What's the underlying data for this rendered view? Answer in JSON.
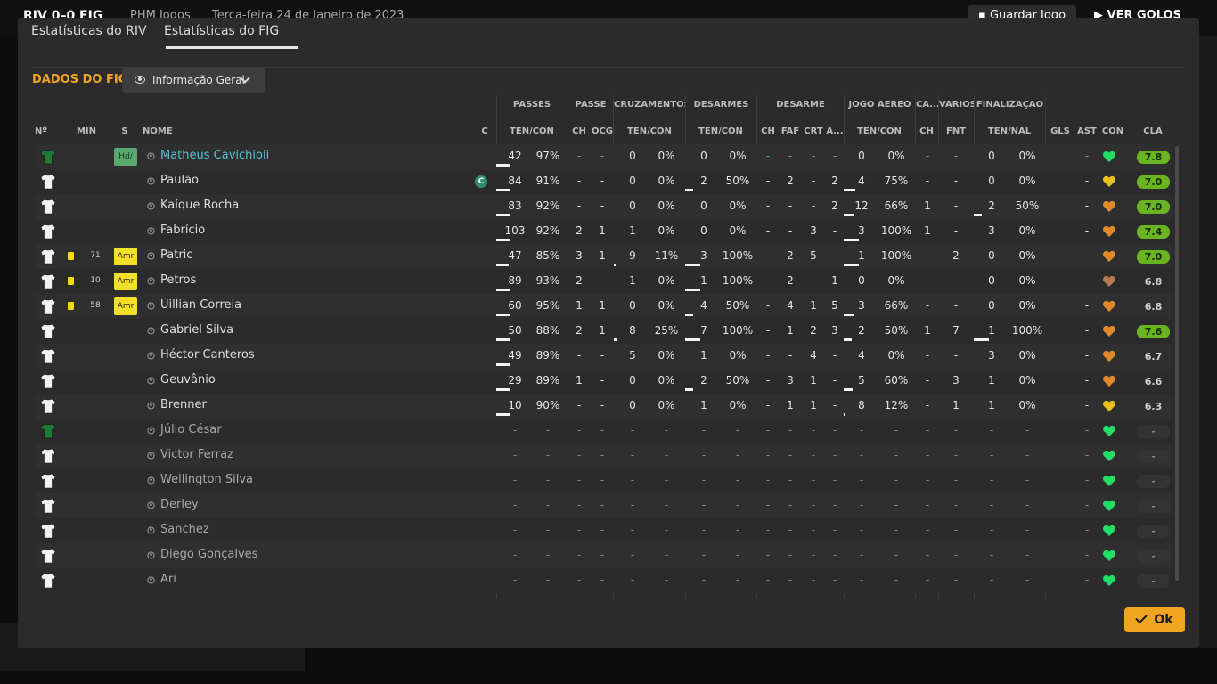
{
  "background": {
    "score": "RIV 0–0 FIG",
    "subtitle": "PHM Jogos",
    "date": "Terça-feira 24 de Janeiro de 2023",
    "save_label": "Guardar Jogo",
    "goals_label": "VER GOLOS"
  },
  "tabs": [
    {
      "label": "Estatísticas do RIV",
      "active": false
    },
    {
      "label": "Estatísticas do FIG",
      "active": true
    }
  ],
  "section": {
    "title": "DADOS DO FIG",
    "dropdown_label": "Informação Geral"
  },
  "group_headers": [
    "PASSES",
    "PASSE",
    "CRUZAMENTOS",
    "DESARMES",
    "DESARME",
    "JOGO AÉREO",
    "CA...",
    "VÁRIOS",
    "FINALIZAÇÃO"
  ],
  "columns": [
    "Nº",
    "MIN",
    "S",
    "NOME",
    "C",
    "TEN/CON",
    "CH",
    "OCG",
    "TEN/CON",
    "TEN/CON",
    "CH",
    "FAF",
    "CRT",
    "A...",
    "TEN/CON",
    "CH",
    "FNT",
    "TEN/NAL",
    "GLS",
    "AST",
    "CON",
    "CLA"
  ],
  "colors": {
    "accent": "#f0a522",
    "rating_good": "#6ab321",
    "heart_green": "#22dd66",
    "heart_yellow": "#e8c21a",
    "heart_orange": "#e08a2a",
    "heart_brown": "#b07a55"
  },
  "players": [
    {
      "kit": "gk",
      "yellow": false,
      "min": "",
      "pos": "Hd/",
      "name": "Matheus Cavichioli",
      "selected": true,
      "captain": false,
      "pass": [
        "42",
        "97%"
      ],
      "pass_ch": "-",
      "pass_ocg": "-",
      "cross": [
        "0",
        "0%"
      ],
      "tack": [
        "0",
        "0%"
      ],
      "tk_ch": "-",
      "tk_faf": "-",
      "tk_crt": "-",
      "tk_a": "-",
      "air": [
        "0",
        "0%"
      ],
      "ca_ch": "-",
      "fnt": "-",
      "shot": [
        "0",
        "0%"
      ],
      "gls": "",
      "ast": "-",
      "heart": "green",
      "rating": "7.8",
      "rating_type": "good",
      "dim": false
    },
    {
      "kit": "w",
      "yellow": false,
      "min": "",
      "pos": "",
      "name": "Paulão",
      "selected": false,
      "captain": true,
      "pass": [
        "84",
        "91%"
      ],
      "pass_ch": "-",
      "pass_ocg": "-",
      "cross": [
        "0",
        "0%"
      ],
      "tack": [
        "2",
        "50%"
      ],
      "tk_ch": "-",
      "tk_faf": "2",
      "tk_crt": "-",
      "tk_a": "2",
      "air": [
        "4",
        "75%"
      ],
      "ca_ch": "-",
      "fnt": "-",
      "shot": [
        "0",
        "0%"
      ],
      "gls": "",
      "ast": "-",
      "heart": "yellow",
      "rating": "7.0",
      "rating_type": "good",
      "dim": false
    },
    {
      "kit": "w",
      "yellow": false,
      "min": "",
      "pos": "",
      "name": "Kaíque Rocha",
      "selected": false,
      "captain": false,
      "pass": [
        "83",
        "92%"
      ],
      "pass_ch": "-",
      "pass_ocg": "-",
      "cross": [
        "0",
        "0%"
      ],
      "tack": [
        "0",
        "0%"
      ],
      "tk_ch": "-",
      "tk_faf": "-",
      "tk_crt": "-",
      "tk_a": "2",
      "air": [
        "12",
        "66%"
      ],
      "ca_ch": "1",
      "fnt": "-",
      "shot": [
        "2",
        "50%"
      ],
      "gls": "",
      "ast": "-",
      "heart": "orange",
      "rating": "7.0",
      "rating_type": "good",
      "dim": false
    },
    {
      "kit": "w",
      "yellow": false,
      "min": "",
      "pos": "",
      "name": "Fabrício",
      "selected": false,
      "captain": false,
      "pass": [
        "103",
        "92%"
      ],
      "pass_ch": "2",
      "pass_ocg": "1",
      "cross": [
        "1",
        "0%"
      ],
      "tack": [
        "0",
        "0%"
      ],
      "tk_ch": "-",
      "tk_faf": "-",
      "tk_crt": "3",
      "tk_a": "-",
      "air": [
        "3",
        "100%"
      ],
      "ca_ch": "1",
      "fnt": "-",
      "shot": [
        "3",
        "0%"
      ],
      "gls": "",
      "ast": "-",
      "heart": "orange",
      "rating": "7.4",
      "rating_type": "good",
      "dim": false
    },
    {
      "kit": "w",
      "yellow": true,
      "min": "71",
      "pos": "Amr",
      "name": "Patric",
      "selected": false,
      "captain": false,
      "pass": [
        "47",
        "85%"
      ],
      "pass_ch": "3",
      "pass_ocg": "1",
      "cross": [
        "9",
        "11%"
      ],
      "tack": [
        "3",
        "100%"
      ],
      "tk_ch": "-",
      "tk_faf": "2",
      "tk_crt": "5",
      "tk_a": "-",
      "air": [
        "1",
        "100%"
      ],
      "ca_ch": "-",
      "fnt": "2",
      "shot": [
        "0",
        "0%"
      ],
      "gls": "",
      "ast": "-",
      "heart": "orange",
      "rating": "7.0",
      "rating_type": "good",
      "dim": false
    },
    {
      "kit": "w",
      "yellow": true,
      "min": "10",
      "pos": "Amr",
      "name": "Petros",
      "selected": false,
      "captain": false,
      "pass": [
        "89",
        "93%"
      ],
      "pass_ch": "2",
      "pass_ocg": "-",
      "cross": [
        "1",
        "0%"
      ],
      "tack": [
        "1",
        "100%"
      ],
      "tk_ch": "-",
      "tk_faf": "2",
      "tk_crt": "-",
      "tk_a": "1",
      "air": [
        "0",
        "0%"
      ],
      "ca_ch": "-",
      "fnt": "-",
      "shot": [
        "0",
        "0%"
      ],
      "gls": "",
      "ast": "-",
      "heart": "brown",
      "rating": "6.8",
      "rating_type": "avg",
      "dim": false
    },
    {
      "kit": "w",
      "yellow": true,
      "min": "58",
      "pos": "Amr",
      "name": "Uillian Correia",
      "selected": false,
      "captain": false,
      "pass": [
        "60",
        "95%"
      ],
      "pass_ch": "1",
      "pass_ocg": "1",
      "cross": [
        "0",
        "0%"
      ],
      "tack": [
        "4",
        "50%"
      ],
      "tk_ch": "-",
      "tk_faf": "4",
      "tk_crt": "1",
      "tk_a": "5",
      "air": [
        "3",
        "66%"
      ],
      "ca_ch": "-",
      "fnt": "-",
      "shot": [
        "0",
        "0%"
      ],
      "gls": "",
      "ast": "-",
      "heart": "orange",
      "rating": "6.8",
      "rating_type": "avg",
      "dim": false
    },
    {
      "kit": "w",
      "yellow": false,
      "min": "",
      "pos": "",
      "name": "Gabriel Silva",
      "selected": false,
      "captain": false,
      "pass": [
        "50",
        "88%"
      ],
      "pass_ch": "2",
      "pass_ocg": "1",
      "cross": [
        "8",
        "25%"
      ],
      "tack": [
        "7",
        "100%"
      ],
      "tk_ch": "-",
      "tk_faf": "1",
      "tk_crt": "2",
      "tk_a": "3",
      "air": [
        "2",
        "50%"
      ],
      "ca_ch": "1",
      "fnt": "7",
      "shot": [
        "1",
        "100%"
      ],
      "gls": "",
      "ast": "-",
      "heart": "orange",
      "rating": "7.6",
      "rating_type": "good",
      "dim": false
    },
    {
      "kit": "w",
      "yellow": false,
      "min": "",
      "pos": "",
      "name": "Héctor Canteros",
      "selected": false,
      "captain": false,
      "pass": [
        "49",
        "89%"
      ],
      "pass_ch": "-",
      "pass_ocg": "-",
      "cross": [
        "5",
        "0%"
      ],
      "tack": [
        "1",
        "0%"
      ],
      "tk_ch": "-",
      "tk_faf": "-",
      "tk_crt": "4",
      "tk_a": "-",
      "air": [
        "4",
        "0%"
      ],
      "ca_ch": "-",
      "fnt": "-",
      "shot": [
        "3",
        "0%"
      ],
      "gls": "",
      "ast": "-",
      "heart": "orange",
      "rating": "6.7",
      "rating_type": "avg",
      "dim": false
    },
    {
      "kit": "w",
      "yellow": false,
      "min": "",
      "pos": "",
      "name": "Geuvânio",
      "selected": false,
      "captain": false,
      "pass": [
        "29",
        "89%"
      ],
      "pass_ch": "1",
      "pass_ocg": "-",
      "cross": [
        "0",
        "0%"
      ],
      "tack": [
        "2",
        "50%"
      ],
      "tk_ch": "-",
      "tk_faf": "3",
      "tk_crt": "1",
      "tk_a": "-",
      "air": [
        "5",
        "60%"
      ],
      "ca_ch": "-",
      "fnt": "3",
      "shot": [
        "1",
        "0%"
      ],
      "gls": "",
      "ast": "-",
      "heart": "orange",
      "rating": "6.6",
      "rating_type": "avg",
      "dim": false
    },
    {
      "kit": "w",
      "yellow": false,
      "min": "",
      "pos": "",
      "name": "Brenner",
      "selected": false,
      "captain": false,
      "pass": [
        "10",
        "90%"
      ],
      "pass_ch": "-",
      "pass_ocg": "-",
      "cross": [
        "0",
        "0%"
      ],
      "tack": [
        "1",
        "0%"
      ],
      "tk_ch": "-",
      "tk_faf": "1",
      "tk_crt": "1",
      "tk_a": "-",
      "air": [
        "8",
        "12%"
      ],
      "ca_ch": "-",
      "fnt": "1",
      "shot": [
        "1",
        "0%"
      ],
      "gls": "",
      "ast": "-",
      "heart": "yellow",
      "rating": "6.3",
      "rating_type": "avg",
      "dim": false
    },
    {
      "kit": "gk",
      "yellow": false,
      "min": "",
      "pos": "",
      "name": "Júlio César",
      "selected": false,
      "captain": false,
      "dim": true,
      "heart": "green",
      "rating": "-",
      "rating_type": "none"
    },
    {
      "kit": "w",
      "yellow": false,
      "min": "",
      "pos": "",
      "name": "Victor Ferraz",
      "selected": false,
      "captain": false,
      "dim": true,
      "heart": "green",
      "rating": "-",
      "rating_type": "none"
    },
    {
      "kit": "w",
      "yellow": false,
      "min": "",
      "pos": "",
      "name": "Wellington Silva",
      "selected": false,
      "captain": false,
      "dim": true,
      "heart": "green",
      "rating": "-",
      "rating_type": "none"
    },
    {
      "kit": "w",
      "yellow": false,
      "min": "",
      "pos": "",
      "name": "Derley",
      "selected": false,
      "captain": false,
      "dim": true,
      "heart": "green",
      "rating": "-",
      "rating_type": "none"
    },
    {
      "kit": "w",
      "yellow": false,
      "min": "",
      "pos": "",
      "name": "Sanchez",
      "selected": false,
      "captain": false,
      "dim": true,
      "heart": "green",
      "rating": "-",
      "rating_type": "none"
    },
    {
      "kit": "w",
      "yellow": false,
      "min": "",
      "pos": "",
      "name": "Diego Gonçalves",
      "selected": false,
      "captain": false,
      "dim": true,
      "heart": "green",
      "rating": "-",
      "rating_type": "none"
    },
    {
      "kit": "w",
      "yellow": false,
      "min": "",
      "pos": "",
      "name": "Ari",
      "selected": false,
      "captain": false,
      "dim": true,
      "heart": "green",
      "rating": "-",
      "rating_type": "none"
    }
  ],
  "ok_label": "Ok"
}
